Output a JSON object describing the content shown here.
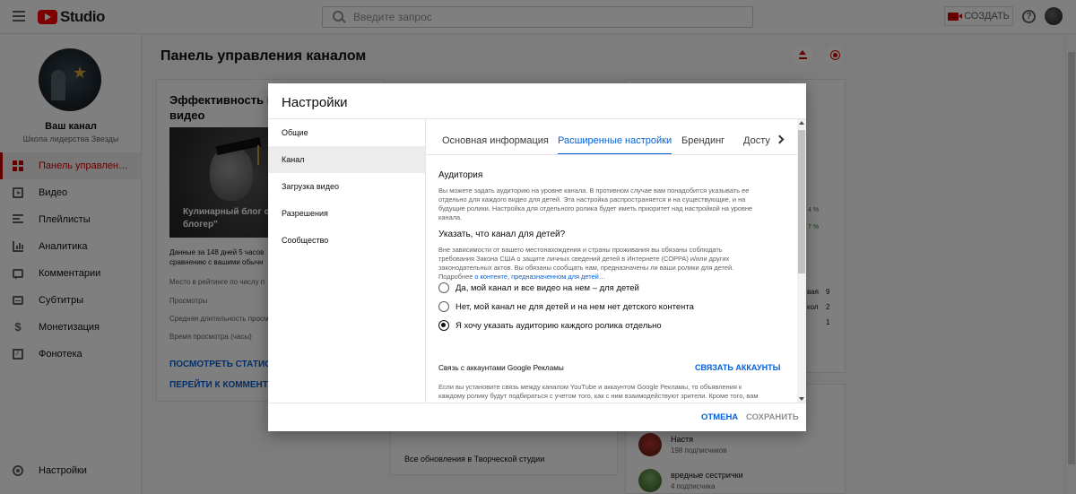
{
  "topbar": {
    "logo_text": "Studio",
    "search_placeholder": "Введите запрос",
    "create_label": "Создать",
    "help_glyph": "?"
  },
  "sidebar": {
    "channel_name": "Ваш канал",
    "channel_subtitle": "Школа лидерства Звезды",
    "items": [
      {
        "label": "Панель управлен…",
        "icon": "dashboard-icon",
        "active": true
      },
      {
        "label": "Видео",
        "icon": "video-icon"
      },
      {
        "label": "Плейлисты",
        "icon": "playlist-icon"
      },
      {
        "label": "Аналитика",
        "icon": "analytics-icon"
      },
      {
        "label": "Комментарии",
        "icon": "comment-icon"
      },
      {
        "label": "Субтитры",
        "icon": "subtitles-icon"
      },
      {
        "label": "Монетизация",
        "icon": "dollar-icon"
      },
      {
        "label": "Фонотека",
        "icon": "audio-library-icon"
      }
    ],
    "settings_label": "Настройки"
  },
  "main": {
    "page_title": "Панель управления каналом",
    "card1": {
      "title": "Эффективность нед… видео",
      "title_top": "Эффективность недa",
      "title_bottom": "видео",
      "thumb_title": "Кулинарный блог от б… блогер\"",
      "thumb_title_l1": "Кулинарный блог от б",
      "thumb_title_l2": "блогер\"",
      "period_l1": "Данные за 148 дней 5 часов",
      "period_l2": "сравнению с вашими обычн",
      "rank": "Место в рейтинге по числу п",
      "views": "Просмотры",
      "avg_duration": "Средняя длительность просм",
      "watch_time": "Время просмотра (часы)",
      "link_stats": "Посмотреть статистик",
      "link_comments": "Перейти к комментари"
    },
    "card2": {
      "text": "Все обновления в Творческой студии"
    },
    "card3": {
      "pct1": "4 %",
      "pct2": "7 %",
      "row1": "вая",
      "row2": "кол",
      "num1": "9",
      "num2": "2",
      "num3": "1"
    },
    "card4": {
      "subscribers": [
        {
          "name": "Настя",
          "count": "198 подписчиков"
        },
        {
          "name": "вредные сестрички",
          "count": "4 подписчика"
        }
      ]
    }
  },
  "dialog": {
    "title": "Настройки",
    "left_menu": [
      "Общие",
      "Канал",
      "Загрузка видео",
      "Разрешения",
      "Сообщество"
    ],
    "active_left": "Канал",
    "tabs": [
      "Основная информация",
      "Расширенные настройки",
      "Брендинг",
      "Досту"
    ],
    "active_tab": "Расширенные настройки",
    "audience": {
      "heading": "Аудитория",
      "desc_l1": "Вы можете задать аудиторию на уровне канала. В противном случае вам понадобится указывать ее",
      "desc_l2": "отдельно для каждого видео для детей. Эта настройка распространяется и на существующие, и на",
      "desc_l3": "будущие ролики. Настройка для отдельного ролика будет иметь приоритет над настройкой на уровне",
      "desc_l4": "канала.",
      "question": "Указать, что канал для детей?",
      "coppa_l1": "Вне зависимости от вашего местонахождения и страны проживания вы обязаны соблюдать",
      "coppa_l2": "требования Закона США о защите личных сведений детей в Интернете (COPPA) и/или других",
      "coppa_l3": "законодательных актов. Вы обязаны сообщать нам, предназначены ли ваши ролики для детей.",
      "coppa_l4_prefix": "Подробнее ",
      "coppa_link": "о контенте, предназначенном для детей…",
      "options": [
        "Да, мой канал и все видео на нем – для детей",
        "Нет, мой канал не для детей и на нем нет детского контента",
        "Я хочу указать аудиторию каждого ролика отдельно"
      ],
      "selected_option": 2
    },
    "ads": {
      "heading": "Связь с аккаунтами Google Рекламы",
      "link_button": "Связать аккаунты",
      "desc_l1": "Если вы установите связь между каналом YouTube и аккаунтом Google Рекламы, то объявления к",
      "desc_l2": "каждому ролику будут подбираться с учетом того, как с ним взаимодействуют зрители. Кроме того, вам"
    },
    "cancel_label": "Отмена",
    "save_label": "Сохранить"
  },
  "colors": {
    "accent_red": "#cc0000",
    "link_blue": "#065fd4",
    "overlay": "rgba(0,0,0,0.5)"
  }
}
